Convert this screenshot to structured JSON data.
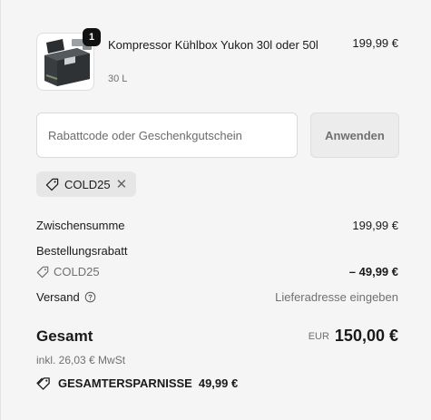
{
  "product": {
    "quantity": "1",
    "name": "Kompressor Kühlbox Yukon 30l oder 50l",
    "variant": "30 L",
    "price": "199,99 €"
  },
  "discount": {
    "placeholder": "Rabattcode oder Geschenkgutschein",
    "apply_label": "Anwenden",
    "applied_code": "COLD25"
  },
  "summary": {
    "subtotal_label": "Zwischensumme",
    "subtotal_value": "199,99 €",
    "order_discount_label": "Bestellungsrabatt",
    "discount_code": "COLD25",
    "discount_value": "– 49,99 €",
    "shipping_label": "Versand",
    "shipping_value": "Lieferadresse eingeben",
    "total_label": "Gesamt",
    "total_currency": "EUR",
    "total_value": "150,00 €",
    "tax_note": "inkl. 26,03 € MwSt",
    "savings_label": "GESAMTERSPARNISSE",
    "savings_value": "49,99 €"
  }
}
